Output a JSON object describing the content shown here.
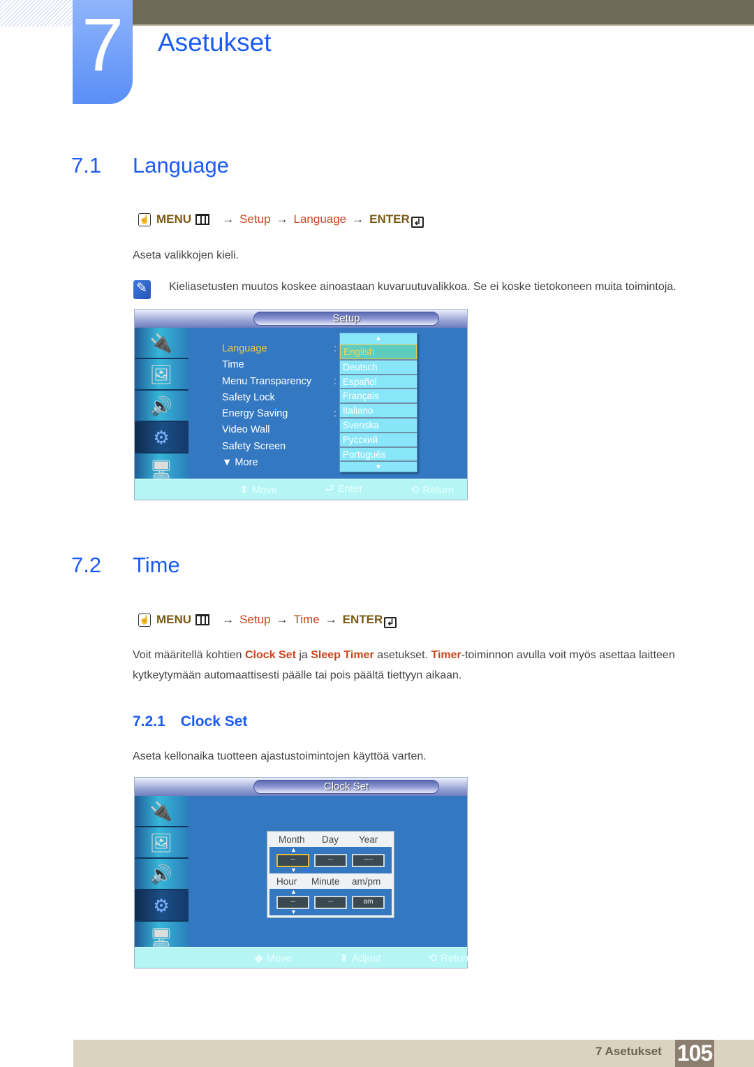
{
  "header": {
    "chapter_number": "7",
    "chapter_title": "Asetukset"
  },
  "section_language": {
    "number": "7.1",
    "title": "Language",
    "path": {
      "menu": "MENU",
      "arrow": "→",
      "steps": [
        "Setup",
        "Language"
      ],
      "enter": "ENTER"
    },
    "description": "Aseta valikkojen kieli.",
    "note": "Kieliasetusten muutos koskee ainoastaan kuvaruutuvalikkoa. Se ei koske tietokoneen muita toimintoja.",
    "osd": {
      "title": "Setup",
      "sidebar_icons": [
        "input-icon",
        "picture-icon",
        "sound-icon",
        "setup-gear-icon",
        "multi-control-icon"
      ],
      "active_sidebar_index": 3,
      "menu_items": [
        {
          "label": "Language",
          "selected": true,
          "colon": true
        },
        {
          "label": "Time",
          "selected": false,
          "colon": false
        },
        {
          "label": "Menu Transparency",
          "selected": false,
          "colon": true
        },
        {
          "label": "Safety Lock",
          "selected": false,
          "colon": false
        },
        {
          "label": "Energy Saving",
          "selected": false,
          "colon": true
        },
        {
          "label": "Video Wall",
          "selected": false,
          "colon": false
        },
        {
          "label": "Safety Screen",
          "selected": false,
          "colon": false
        },
        {
          "label": "▼ More",
          "selected": false,
          "colon": false
        }
      ],
      "languages": [
        "English",
        "Deutsch",
        "Español",
        "Français",
        "Italiano",
        "Svenska",
        "Русский",
        "Português"
      ],
      "selected_language": "English",
      "footer": [
        {
          "glyph": "⬍",
          "label": "Move"
        },
        {
          "glyph": "⮐",
          "label": "Enter"
        },
        {
          "glyph": "⟲",
          "label": "Return"
        }
      ]
    }
  },
  "section_time": {
    "number": "7.2",
    "title": "Time",
    "path": {
      "menu": "MENU",
      "arrow": "→",
      "steps": [
        "Setup",
        "Time"
      ],
      "enter": "ENTER"
    },
    "paragraph": {
      "t1": "Voit määritellä kohtien ",
      "h1": "Clock Set",
      "t2": " ja ",
      "h2": "Sleep Timer",
      "t3": " asetukset. ",
      "h3": "Timer",
      "t4": "-toiminnon avulla voit myös asettaa laitteen kytkeytymään automaattisesti päälle tai pois päältä tiettyyn aikaan."
    }
  },
  "section_clock": {
    "number": "7.2.1",
    "title": "Clock Set",
    "description": "Aseta kellonaika tuotteen ajastustoimintojen käyttöä varten.",
    "osd": {
      "title": "Clock Set",
      "date_labels": [
        "Month",
        "Day",
        "Year"
      ],
      "date_values": [
        "--",
        "--",
        "----"
      ],
      "time_labels": [
        "Hour",
        "Minute",
        "am/pm"
      ],
      "time_values": [
        "--",
        "--",
        "am"
      ],
      "footer": [
        {
          "glyph": "◆",
          "label": "Move"
        },
        {
          "glyph": "⬍",
          "label": "Adjust"
        },
        {
          "glyph": "⟲",
          "label": "Return"
        }
      ]
    }
  },
  "footer": {
    "chapter_label": "7 Asetukset",
    "page_number": "105"
  }
}
